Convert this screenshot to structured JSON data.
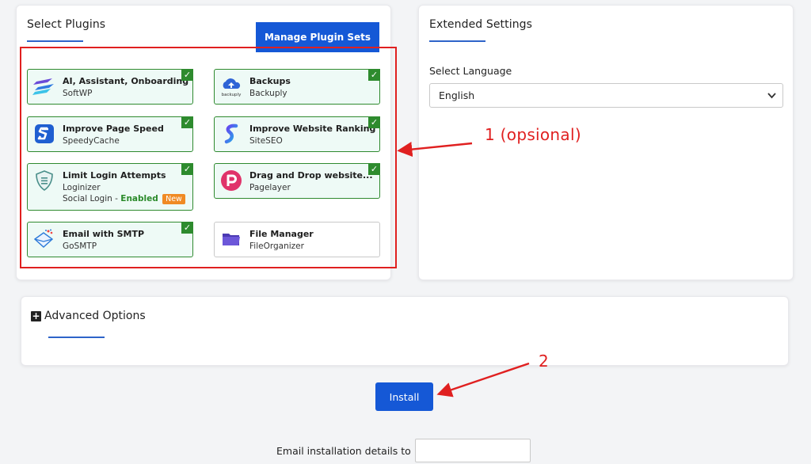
{
  "plugins_card": {
    "title": "Select Plugins",
    "manage_button": "Manage Plugin Sets",
    "plugins": [
      {
        "name": "AI, Assistant, Onboarding",
        "sub": "SoftWP",
        "checked": true,
        "icon": "softwp-icon"
      },
      {
        "name": "Backups",
        "sub": "Backuply",
        "checked": true,
        "icon": "backuply-cloud-icon"
      },
      {
        "name": "Improve Page Speed",
        "sub": "SpeedyCache",
        "checked": true,
        "icon": "speedycache-icon"
      },
      {
        "name": "Improve Website Ranking",
        "sub": "SiteSEO",
        "checked": true,
        "icon": "siteseo-icon"
      },
      {
        "name": "Limit Login Attempts",
        "sub": "Loginizer",
        "extra_prefix": "Social Login - ",
        "extra_enabled": "Enabled",
        "extra_badge": "New",
        "checked": true,
        "icon": "loginizer-shield-icon"
      },
      {
        "name": "Drag and Drop website...",
        "sub": "Pagelayer",
        "checked": true,
        "icon": "pagelayer-icon"
      },
      {
        "name": "Email with SMTP",
        "sub": "GoSMTP",
        "checked": true,
        "icon": "gosmtp-envelope-icon"
      },
      {
        "name": "File Manager",
        "sub": "FileOrganizer",
        "checked": false,
        "icon": "folder-icon"
      }
    ],
    "backuply_logo_text": "backuply",
    "check_mark": "✓"
  },
  "extended_card": {
    "title": "Extended Settings",
    "language_label": "Select Language",
    "language_value": "English"
  },
  "advanced": {
    "title": "Advanced Options",
    "plus": "+"
  },
  "install_button": "Install",
  "email_label": "Email installation details to :",
  "annotations": {
    "one": "1 (opsional)",
    "two": "2"
  },
  "colors": {
    "accent": "#1558d6",
    "check_green": "#2e8b2e",
    "annotation_red": "#e02020"
  }
}
